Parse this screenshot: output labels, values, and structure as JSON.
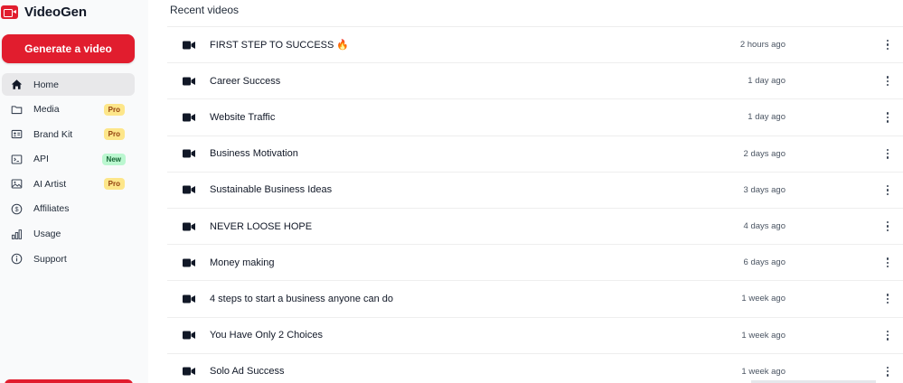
{
  "brand": {
    "name": "VideoGen",
    "logo_icon": "video-camera-icon",
    "color": "#e11d2e"
  },
  "sidebar": {
    "generate_label": "Generate a video",
    "items": [
      {
        "label": "Home",
        "icon": "home-icon",
        "active": true,
        "badge": ""
      },
      {
        "label": "Media",
        "icon": "folder-icon",
        "badge": "Pro"
      },
      {
        "label": "Brand Kit",
        "icon": "id-card-icon",
        "badge": "Pro"
      },
      {
        "label": "API",
        "icon": "terminal-icon",
        "badge": "New"
      },
      {
        "label": "AI Artist",
        "icon": "image-icon",
        "badge": "Pro"
      },
      {
        "label": "Affiliates",
        "icon": "dollar-icon",
        "badge": ""
      },
      {
        "label": "Usage",
        "icon": "bar-chart-icon",
        "badge": ""
      },
      {
        "label": "Support",
        "icon": "info-icon",
        "badge": ""
      }
    ]
  },
  "main": {
    "section_title": "Recent videos",
    "videos": [
      {
        "title": "FIRST STEP TO SUCCESS 🔥",
        "time": "2 hours ago"
      },
      {
        "title": "Career Success",
        "time": "1 day ago"
      },
      {
        "title": "Website Traffic",
        "time": "1 day ago"
      },
      {
        "title": "Business Motivation",
        "time": "2 days ago"
      },
      {
        "title": "Sustainable Business Ideas",
        "time": "3 days ago"
      },
      {
        "title": "NEVER LOOSE HOPE",
        "time": "4 days ago"
      },
      {
        "title": "Money making",
        "time": "6 days ago"
      },
      {
        "title": "4 steps to start a business anyone can do",
        "time": "1 week ago"
      },
      {
        "title": "You Have Only 2 Choices",
        "time": "1 week ago"
      },
      {
        "title": "Solo Ad Success",
        "time": "1 week ago"
      }
    ]
  }
}
